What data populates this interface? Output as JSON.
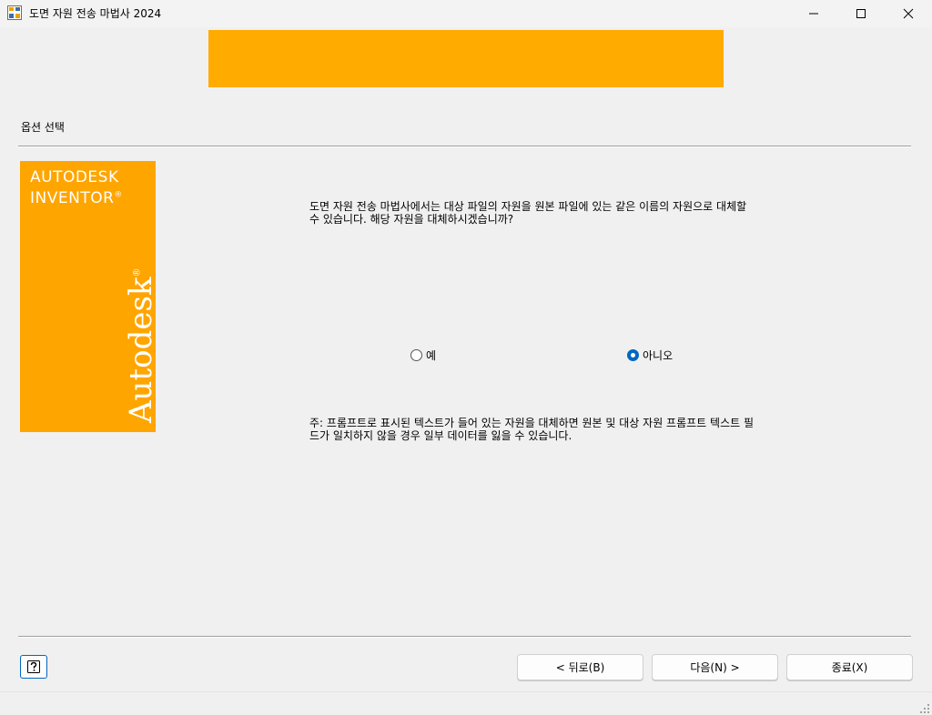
{
  "window": {
    "title": "도면 자원 전송 마법사 2024",
    "icons": [
      "app-icon",
      "minimize-icon",
      "maximize-icon",
      "close-icon"
    ]
  },
  "colors": {
    "banner": "#ffab00",
    "logo_panel": "#ffa500",
    "accent": "#0067c0"
  },
  "section": {
    "title": "옵션 선택"
  },
  "logo": {
    "line1": "AUTODESK",
    "line2": "INVENTOR",
    "registered": "®",
    "vertical": "Autodesk",
    "vertical_mark": "®"
  },
  "main": {
    "question_line1": "도면 자원 전송 마법사에서는 대상 파일의 자원을 원본 파일에 있는 같은 이름의 자원으로 대체할",
    "question_line2": "수 있습니다. 해당 자원을 대체하시겠습니까?",
    "options": [
      {
        "label": "예",
        "checked": false
      },
      {
        "label": "아니오",
        "checked": true
      }
    ],
    "note_line1": "주: 프롬프트로 표시된 텍스트가 들어 있는 자원을 대체하면 원본 및 대상 자원 프롬프트 텍스트 필",
    "note_line2": "드가 일치하지 않을 경우 일부 데이터를 잃을 수 있습니다."
  },
  "footer": {
    "help_icon": "help-icon",
    "back_label": "< 뒤로(B)",
    "next_label": "다음(N) >",
    "finish_label": "종료(X)"
  }
}
